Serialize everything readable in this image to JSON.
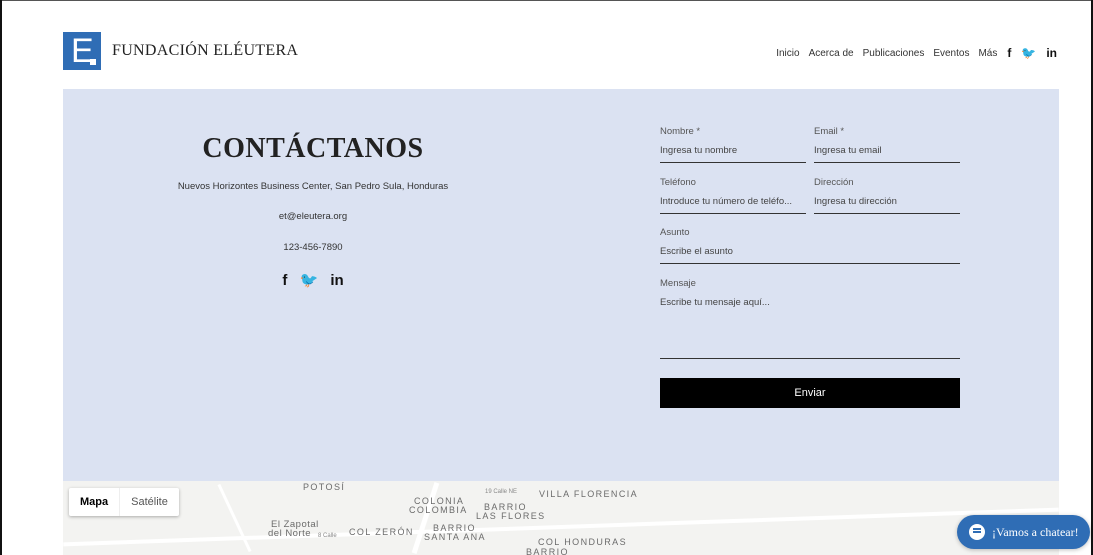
{
  "header": {
    "logo_letter": "E",
    "brand": "FUNDACIÓN ELÉUTERA",
    "nav": [
      "Inicio",
      "Acerca de",
      "Publicaciones",
      "Eventos",
      "Más"
    ],
    "social": [
      "f",
      "🐦",
      "in"
    ]
  },
  "contact": {
    "title": "CONTÁCTANOS",
    "address": "Nuevos Horizontes Business Center, San Pedro Sula, Honduras",
    "email": "et@eleutera.org",
    "phone": "123-456-7890",
    "social": [
      "f",
      "🐦",
      "in"
    ]
  },
  "form": {
    "nombre_label": "Nombre *",
    "nombre_placeholder": "Ingresa tu nombre",
    "email_label": "Email *",
    "email_placeholder": "Ingresa tu email",
    "telefono_label": "Teléfono",
    "telefono_placeholder": "Introduce tu número de teléfo...",
    "direccion_label": "Dirección",
    "direccion_placeholder": "Ingresa tu dirección",
    "asunto_label": "Asunto",
    "asunto_placeholder": "Escribe el asunto",
    "mensaje_label": "Mensaje",
    "mensaje_placeholder": "Escribe tu mensaje aquí...",
    "submit_label": "Enviar"
  },
  "map": {
    "toggle": [
      "Mapa",
      "Satélite"
    ],
    "labels": {
      "potosi": "POTOSÍ",
      "villa_florencia": "VILLA FLORENCIA",
      "colonia_colombia_1": "COLONIA",
      "colonia_colombia_2": "COLOMBIA",
      "barrio_las_flores_1": "BARRIO",
      "barrio_las_flores_2": "LAS FLORES",
      "el_zapotal_1": "El Zapotal",
      "el_zapotal_2": "del Norte",
      "col_zeron": "COL ZERÓN",
      "barrio_santa_ana_1": "BARRIO",
      "barrio_santa_ana_2": "SANTA ANA",
      "col_honduras": "COL HONDURAS",
      "barrio_bottom": "BARRIO",
      "street_19": "19 Calle NE",
      "street_8": "8 Calle"
    }
  },
  "chat": {
    "label": "¡Vamos a chatear!"
  },
  "colors": {
    "accent": "#2f6db5",
    "section_bg": "#dbe2f2",
    "button_bg": "#000000"
  }
}
